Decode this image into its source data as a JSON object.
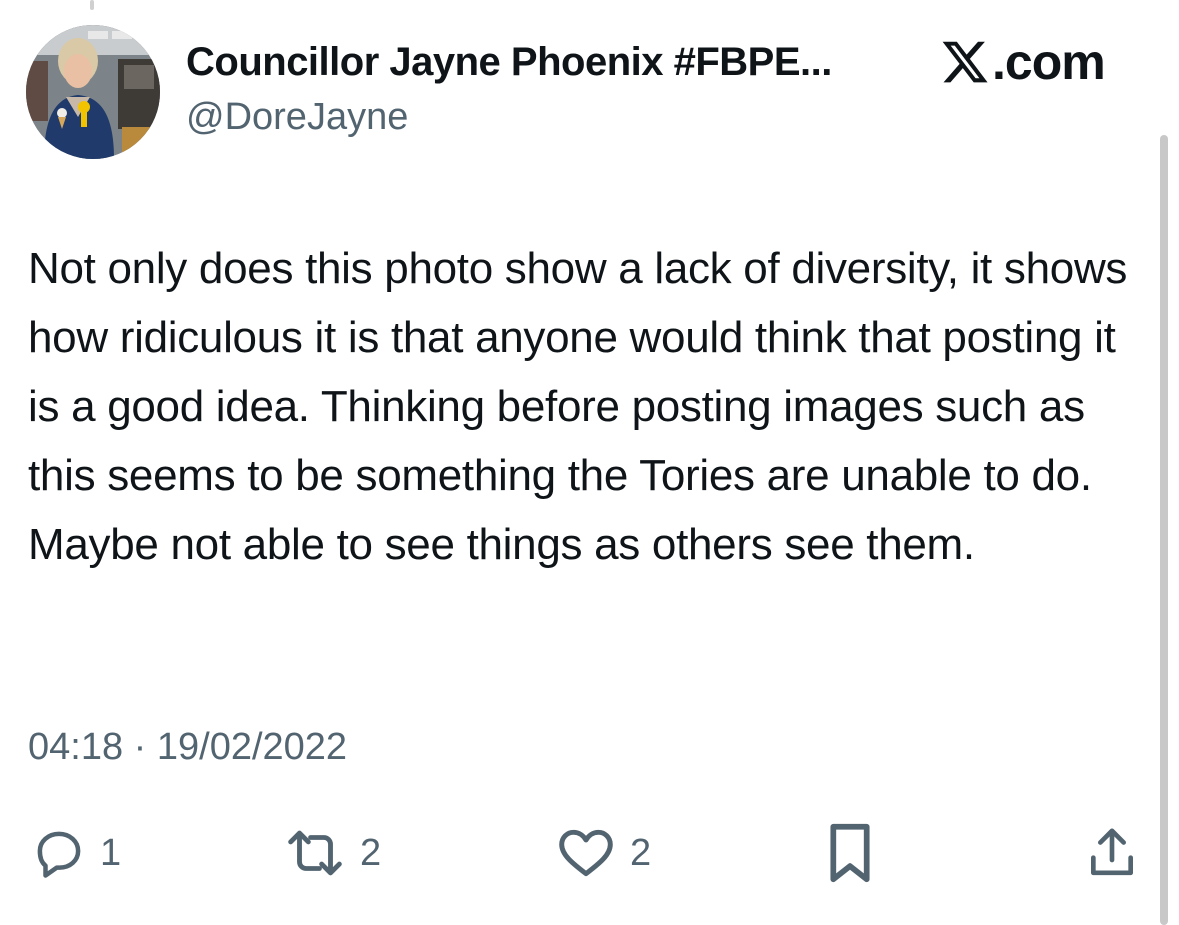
{
  "author": {
    "display_name": "Councillor Jayne Phoenix #FBPE...",
    "handle": "@DoreJayne",
    "avatar_icon": "profile-photo"
  },
  "brand": {
    "logo_icon": "x-logo-icon",
    "domain": ".com"
  },
  "tweet": {
    "text": "Not only does this photo show a lack of diversity, it shows how ridiculous it is that anyone would think that posting it is a good idea. Thinking before posting images such as this seems to be something the Tories are unable to do. Maybe not able to see things as others see them.",
    "timestamp": "04:18 · 19/02/2022"
  },
  "actions": {
    "reply": {
      "icon": "reply-icon",
      "count": "1"
    },
    "repost": {
      "icon": "repost-icon",
      "count": "2"
    },
    "like": {
      "icon": "heart-icon",
      "count": "2"
    },
    "bookmark": {
      "icon": "bookmark-icon"
    },
    "share": {
      "icon": "share-icon"
    }
  },
  "colors": {
    "text_primary": "#0f1419",
    "text_secondary": "#536471",
    "background": "#ffffff"
  }
}
